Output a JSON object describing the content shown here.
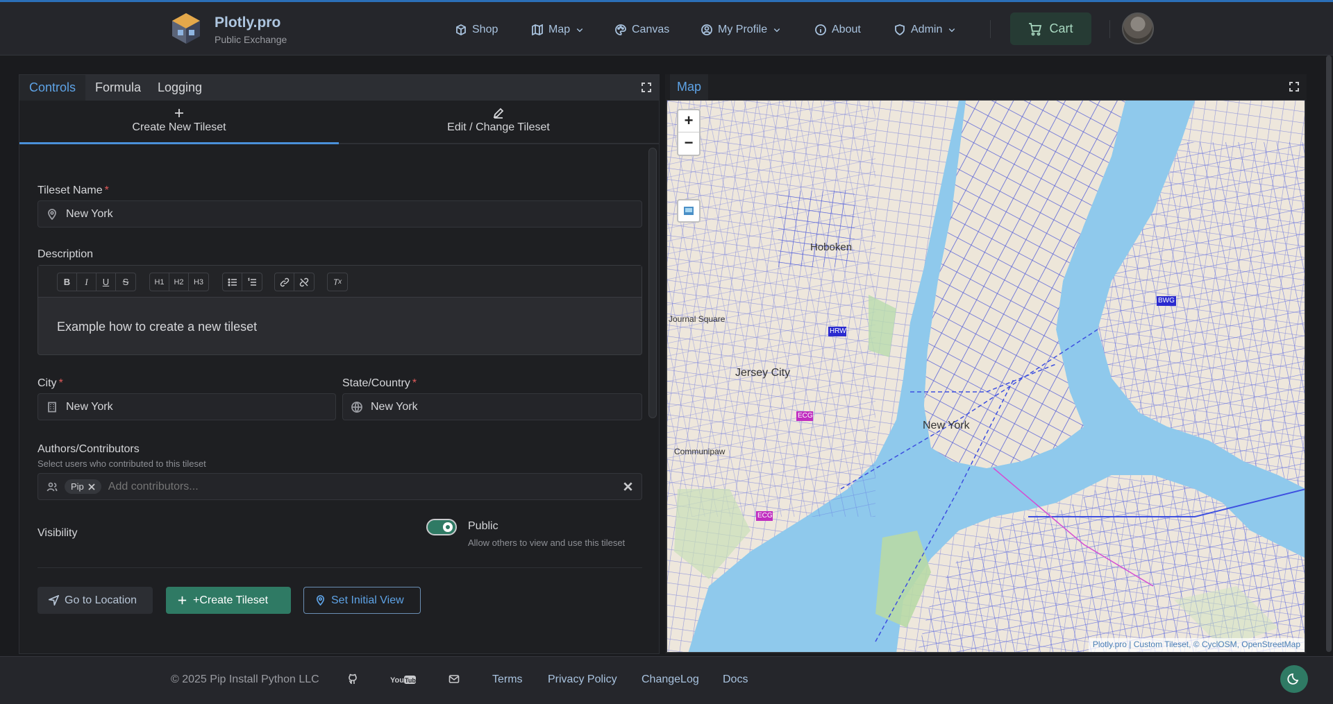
{
  "brand": {
    "title": "Plotly.pro",
    "subtitle": "Public Exchange"
  },
  "nav": {
    "shop": "Shop",
    "map": "Map",
    "canvas": "Canvas",
    "profile": "My Profile",
    "about": "About",
    "admin": "Admin",
    "cart": "Cart"
  },
  "left_tabs": {
    "controls": "Controls",
    "formula": "Formula",
    "logging": "Logging"
  },
  "sub_tabs": {
    "create": "Create New Tileset",
    "edit": "Edit / Change Tileset"
  },
  "form": {
    "tileset_name_label": "Tileset Name",
    "tileset_name_value": "New York",
    "required_mark": "*",
    "description_label": "Description",
    "description_text": "Example how to create a new tileset",
    "toolbar": [
      "B",
      "I",
      "U",
      "S",
      "H1",
      "H2",
      "H3",
      "• list",
      "1. list",
      "link",
      "unlink",
      "clear"
    ],
    "city_label": "City",
    "city_value": "New York",
    "state_label": "State/Country",
    "state_value": "New York",
    "authors_label": "Authors/Contributors",
    "authors_hint": "Select users who contributed to this tileset",
    "author_chip": "Pip",
    "authors_placeholder": "Add contributors...",
    "visibility_label": "Visibility",
    "visibility_state": "Public",
    "visibility_hint": "Allow others to view and use this tileset",
    "visibility_on": true
  },
  "buttons": {
    "go_location": "Go to Location",
    "create_tileset": "+Create Tileset",
    "set_view": "Set Initial View"
  },
  "map": {
    "tab": "Map",
    "labels": {
      "hoboken": "Hoboken",
      "jersey_city": "Jersey City",
      "new_york": "New York",
      "journal_square": "Journal Square",
      "communipaw": "Communipaw",
      "hrw": "HRW",
      "ecg1": "ECG",
      "ecg2": "ECG",
      "bwg": "BWG"
    },
    "attribution": "Plotly.pro | Custom Tileset, © CyclOSM, OpenStreetMap"
  },
  "footer": {
    "copyright": "© 2025 Pip Install Python LLC",
    "terms": "Terms",
    "privacy": "Privacy Policy",
    "changelog": "ChangeLog",
    "docs": "Docs"
  },
  "colors": {
    "accent": "#4a90d9",
    "primary_green": "#2f7a64",
    "water": "#8fc9ec",
    "route_blue": "#3d4fe0"
  }
}
